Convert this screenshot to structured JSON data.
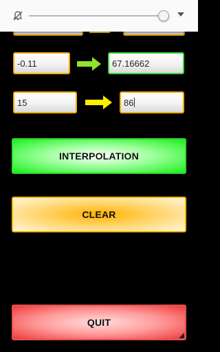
{
  "volume_overlay": {
    "mute_icon": "bell-off-icon",
    "level": 0.99,
    "expand_icon": "chevron-down-icon"
  },
  "rows": [
    {
      "input_value": "-0.11",
      "output_value": "67.16662",
      "arrow_color": "#93e12c"
    },
    {
      "input_value": "15",
      "output_value": "86",
      "arrow_color": "#ffee00"
    }
  ],
  "buttons": {
    "interpolation_label": "INTERPOLATION",
    "clear_label": "CLEAR",
    "quit_label": "QUIT"
  },
  "colors": {
    "field_border": "#f2a900",
    "result_border": "#3ad23a",
    "interpolation": "#19f019",
    "clear": "#ffb200",
    "quit": "#f03a3a"
  }
}
